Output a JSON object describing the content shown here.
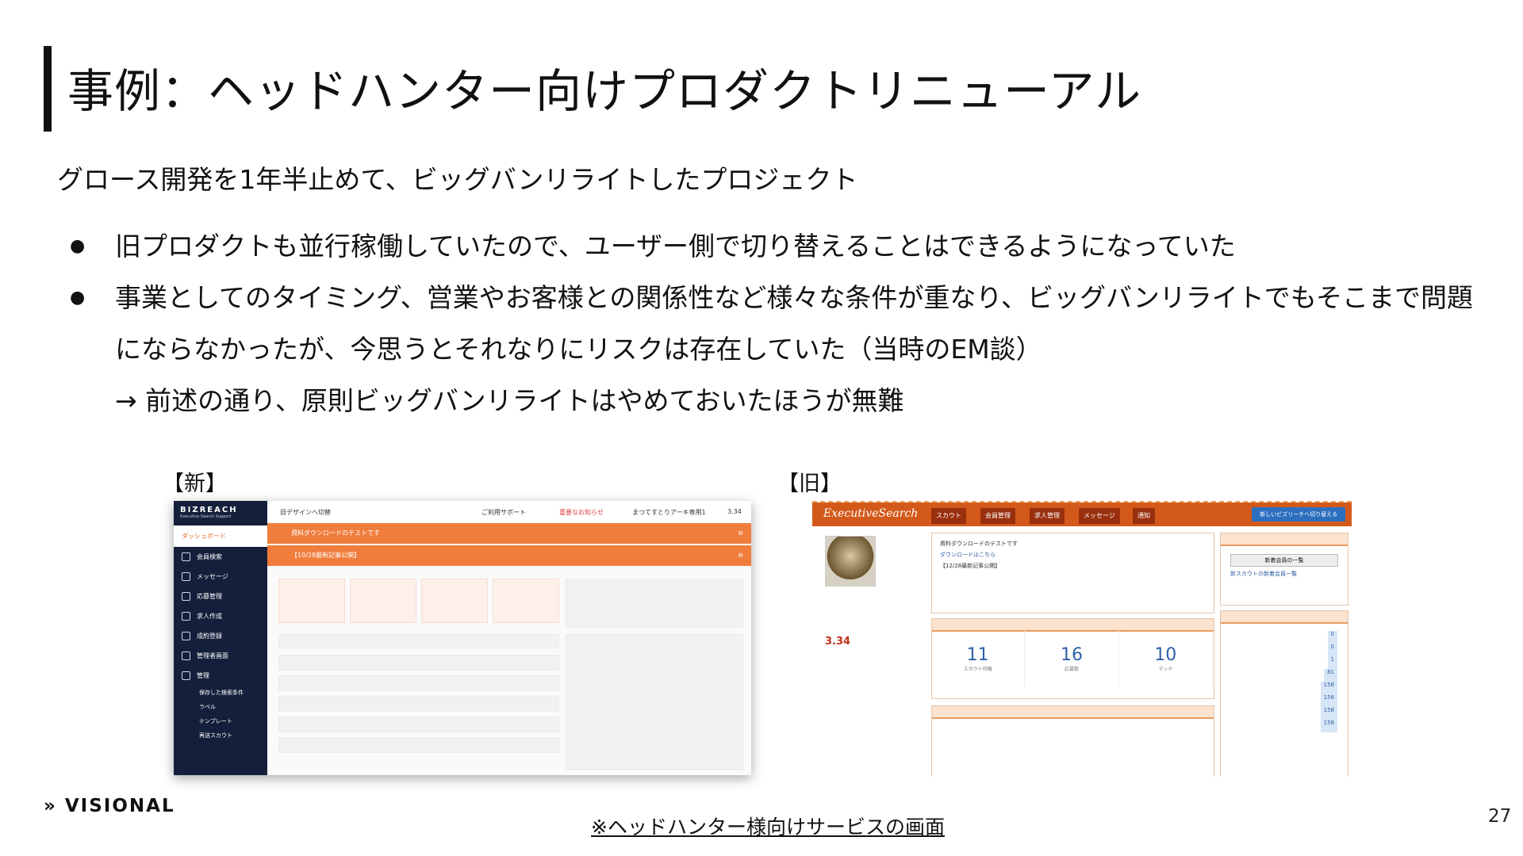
{
  "slide": {
    "title": "事例：ヘッドハンター向けプロダクトリニューアル",
    "subtitle": "グロース開発を1年半止めて、ビッグバンリライトしたプロジェクト",
    "bullets": [
      {
        "lines": [
          "旧プロダクトも並行稼働していたので、ユーザー側で切り替えることはできるようになっていた"
        ]
      },
      {
        "lines": [
          "事業としてのタイミング、営業やお客様との関係性など様々な条件が重なり、ビッグバンリライトでもそこまで問題",
          "にならなかったが、今思うとそれなりにリスクは存在していた（当時のEM談）",
          "→ 前述の通り、原則ビッグバンリライトはやめておいたほうが無難"
        ]
      }
    ],
    "label_new": "【新】",
    "label_old": "【旧】",
    "caption": "※ヘッドハンター様向けサービスの画面",
    "logo": "VISIONAL",
    "page_number": "27"
  },
  "new_screen": {
    "brand": "BIZREACH",
    "brand_sub": "Executive Search Support",
    "nav": [
      "ダッシュボード",
      "会員検索",
      "メッセージ",
      "応募管理",
      "求人作成",
      "成約登録",
      "管理者画面",
      "管理"
    ],
    "subnav": [
      "保存した検索条件",
      "ラベル",
      "テンプレート",
      "再送スカウト"
    ],
    "topbar": {
      "switch": "旧デザインへ切替",
      "support": "ご利用サポート",
      "important": "重要なお知らせ",
      "company": "まつてすとりアーキ専用1",
      "rating": "3.34"
    },
    "notices": [
      "資料ダウンロードのテストです",
      "【10/28最新記事公開】"
    ],
    "colors": {
      "sidebar": "#14203b",
      "accent": "#f07d3c"
    }
  },
  "old_screen": {
    "logo": "ExecutiveSearch",
    "tabs": [
      "スカウト",
      "会員管理",
      "求人管理",
      "メッセージ",
      "通知"
    ],
    "cta": "新しいビズリーチへ切り替える",
    "news": [
      "資料ダウンロードのテストです",
      "ダウンロードはこちら",
      "【12/28最新記事公開】"
    ],
    "rating": "3.34",
    "stats": [
      {
        "value": "11",
        "label": "スカウト待機"
      },
      {
        "value": "16",
        "label": "応募数"
      },
      {
        "value": "10",
        "label": "マッチ"
      }
    ],
    "right_button": "新着会員の一覧",
    "right_link": "新スカウトの新着会員一覧",
    "counts": [
      "0",
      "0",
      "1",
      "81",
      "158",
      "158",
      "158",
      "158"
    ],
    "colors": {
      "header": "#d3591a",
      "tab": "#9a2f0e"
    }
  }
}
